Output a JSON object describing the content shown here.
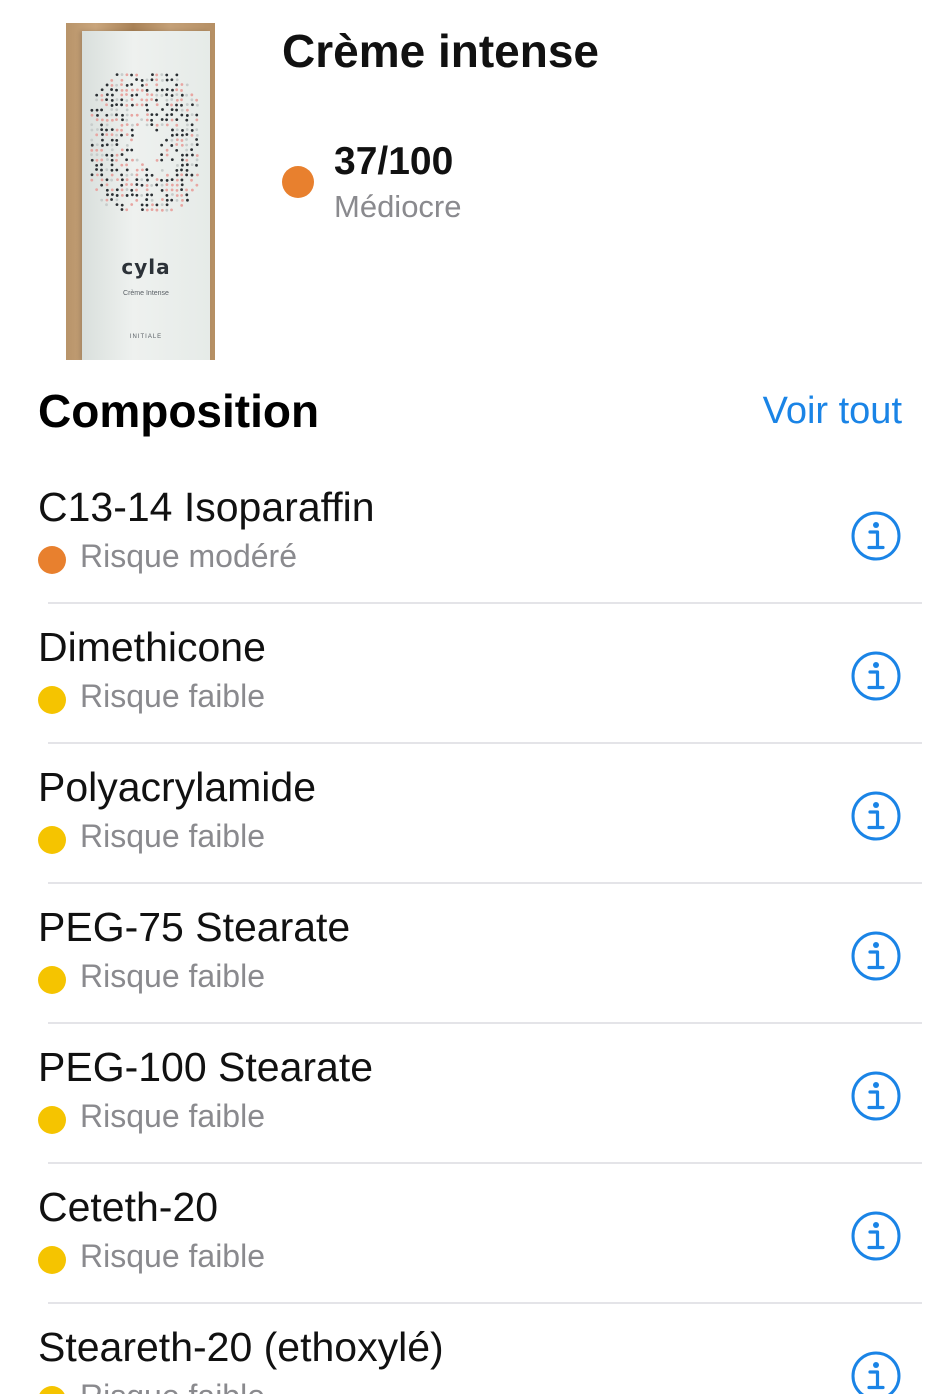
{
  "product": {
    "title": "Crème intense",
    "image": {
      "brand": "cyla",
      "subtitle": "Crème Intense",
      "footer": "INITIALE"
    },
    "score": "37/100",
    "rating": "Médiocre",
    "score_color": "#e8802e"
  },
  "composition": {
    "title": "Composition",
    "see_all_label": "Voir tout",
    "accent_color": "#1a84e6",
    "items": [
      {
        "name": "C13-14 Isoparaffin",
        "risk": "Risque modéré",
        "color": "#e8802e"
      },
      {
        "name": "Dimethicone",
        "risk": "Risque faible",
        "color": "#f5c400"
      },
      {
        "name": "Polyacrylamide",
        "risk": "Risque faible",
        "color": "#f5c400"
      },
      {
        "name": "PEG-75 Stearate",
        "risk": "Risque faible",
        "color": "#f5c400"
      },
      {
        "name": "PEG-100 Stearate",
        "risk": "Risque faible",
        "color": "#f5c400"
      },
      {
        "name": "Ceteth-20",
        "risk": "Risque faible",
        "color": "#f5c400"
      },
      {
        "name": "Steareth-20 (ethoxylé)",
        "risk": "Risque faible",
        "color": "#f5c400"
      }
    ],
    "info_icon": "info-circle-icon"
  }
}
